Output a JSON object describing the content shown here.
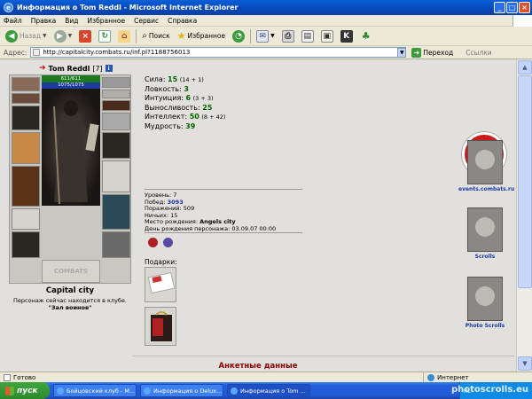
{
  "window": {
    "title": "Информация о Tom Reddl - Microsoft Internet Explorer",
    "menu": [
      "Файл",
      "Правка",
      "Вид",
      "Избранное",
      "Сервис",
      "Справка"
    ]
  },
  "toolbar": {
    "back": "Назад",
    "search": "Поиск",
    "favorites": "Избранное"
  },
  "address": {
    "label": "Адрес:",
    "url": "http://capitalcity.combats.ru/inf.pl?1188756013",
    "go": "Переход",
    "links": "Ссылки"
  },
  "character": {
    "name": "Tom Reddl",
    "level": "[7]",
    "hp": "611/611",
    "mana": "1075/1075",
    "plaque_text": "COMBATS",
    "location_title": "Capital city",
    "location_text": "Персонаж сейчас находится в клубе.",
    "location_place": "\"Зал воинов\""
  },
  "stats": [
    {
      "label": "Сила:",
      "value": "15",
      "extra": "(14 + 1)"
    },
    {
      "label": "Ловкость:",
      "value": "3",
      "extra": ""
    },
    {
      "label": "Интуиция:",
      "value": "6",
      "extra": "(3 + 3)"
    },
    {
      "label": "Выносливость:",
      "value": "25",
      "extra": ""
    },
    {
      "label": "Интеллект:",
      "value": "50",
      "extra": "(8 + 42)"
    },
    {
      "label": "Мудрость:",
      "value": "39",
      "extra": ""
    }
  ],
  "details": {
    "level_label": "Уровень:",
    "level": "7",
    "wins_label": "Побед:",
    "wins": "3093",
    "losses_label": "Поражений:",
    "losses": "509",
    "draws_label": "Ничьих:",
    "draws": "15",
    "birthplace_label": "Место рождения:",
    "birthplace": "Angels city",
    "birthday_label": "День рождения персонажа:",
    "birthday": "03.09.07 00:00"
  },
  "gifts_label": "Подарки:",
  "sidebar": {
    "events": "events.combats.ru",
    "scrolls": "Scrolls",
    "photo_scrolls": "Photo Scrolls"
  },
  "section_title": "Анкетные данные",
  "status": {
    "ready": "Готово",
    "zone": "Интернет"
  },
  "taskbar": {
    "start": "пуск",
    "tasks": [
      "Бойцовский клуб - М...",
      "Информация о Delux...",
      "Информация о Tom ..."
    ],
    "tray_lang": "RL",
    "watermark": "photoscrolls.eu"
  }
}
